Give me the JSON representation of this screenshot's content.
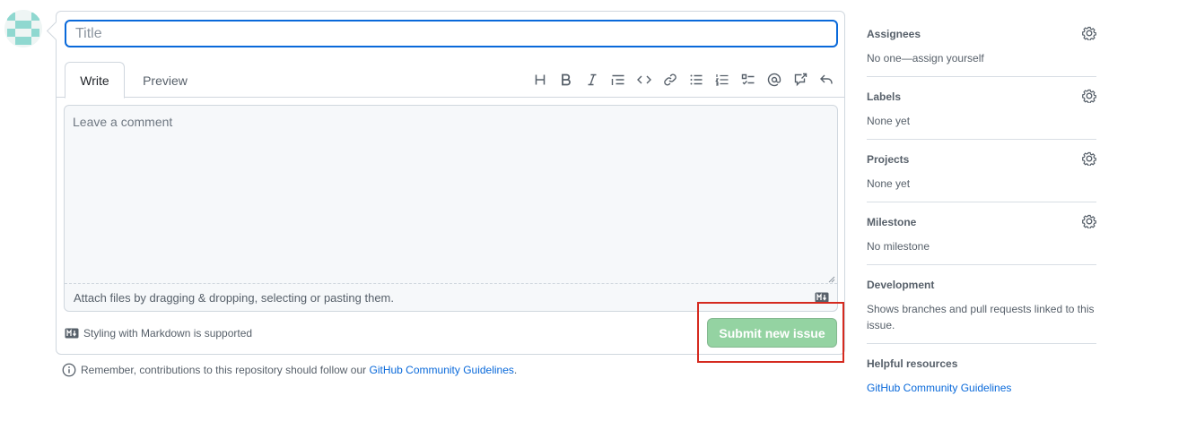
{
  "form": {
    "title_placeholder": "Title",
    "tabs": [
      {
        "label": "Write",
        "active": true
      },
      {
        "label": "Preview",
        "active": false
      }
    ],
    "toolbar": [
      {
        "icon": "heading-icon"
      },
      {
        "icon": "bold-icon"
      },
      {
        "icon": "italic-icon"
      },
      {
        "icon": "quote-icon"
      },
      {
        "icon": "code-icon"
      },
      {
        "icon": "link-icon"
      },
      {
        "icon": "unordered-list-icon"
      },
      {
        "icon": "ordered-list-icon"
      },
      {
        "icon": "task-list-icon"
      },
      {
        "icon": "mention-icon"
      },
      {
        "icon": "cross-reference-icon"
      },
      {
        "icon": "reply-icon"
      }
    ],
    "comment_placeholder": "Leave a comment",
    "attach_text": "Attach files by dragging & dropping, selecting or pasting them.",
    "markdown_note": "Styling with Markdown is supported",
    "submit_label": "Submit new issue",
    "guideline_prefix": "Remember, contributions to this repository should follow our ",
    "guideline_link": "GitHub Community Guidelines",
    "guideline_suffix": "."
  },
  "sidebar": {
    "sections": [
      {
        "heading": "Assignees",
        "value": "No one—assign yourself",
        "has_gear": true
      },
      {
        "heading": "Labels",
        "value": "None yet",
        "has_gear": true
      },
      {
        "heading": "Projects",
        "value": "None yet",
        "has_gear": true
      },
      {
        "heading": "Milestone",
        "value": "No milestone",
        "has_gear": true
      },
      {
        "heading": "Development",
        "value": "Shows branches and pull requests linked to this issue.",
        "has_gear": false
      }
    ],
    "helpful": {
      "heading": "Helpful resources",
      "link": "GitHub Community Guidelines"
    }
  },
  "colors": {
    "accent": "#0969da",
    "submit_disabled": "#94d3a2",
    "highlight": "#d52a1f"
  }
}
